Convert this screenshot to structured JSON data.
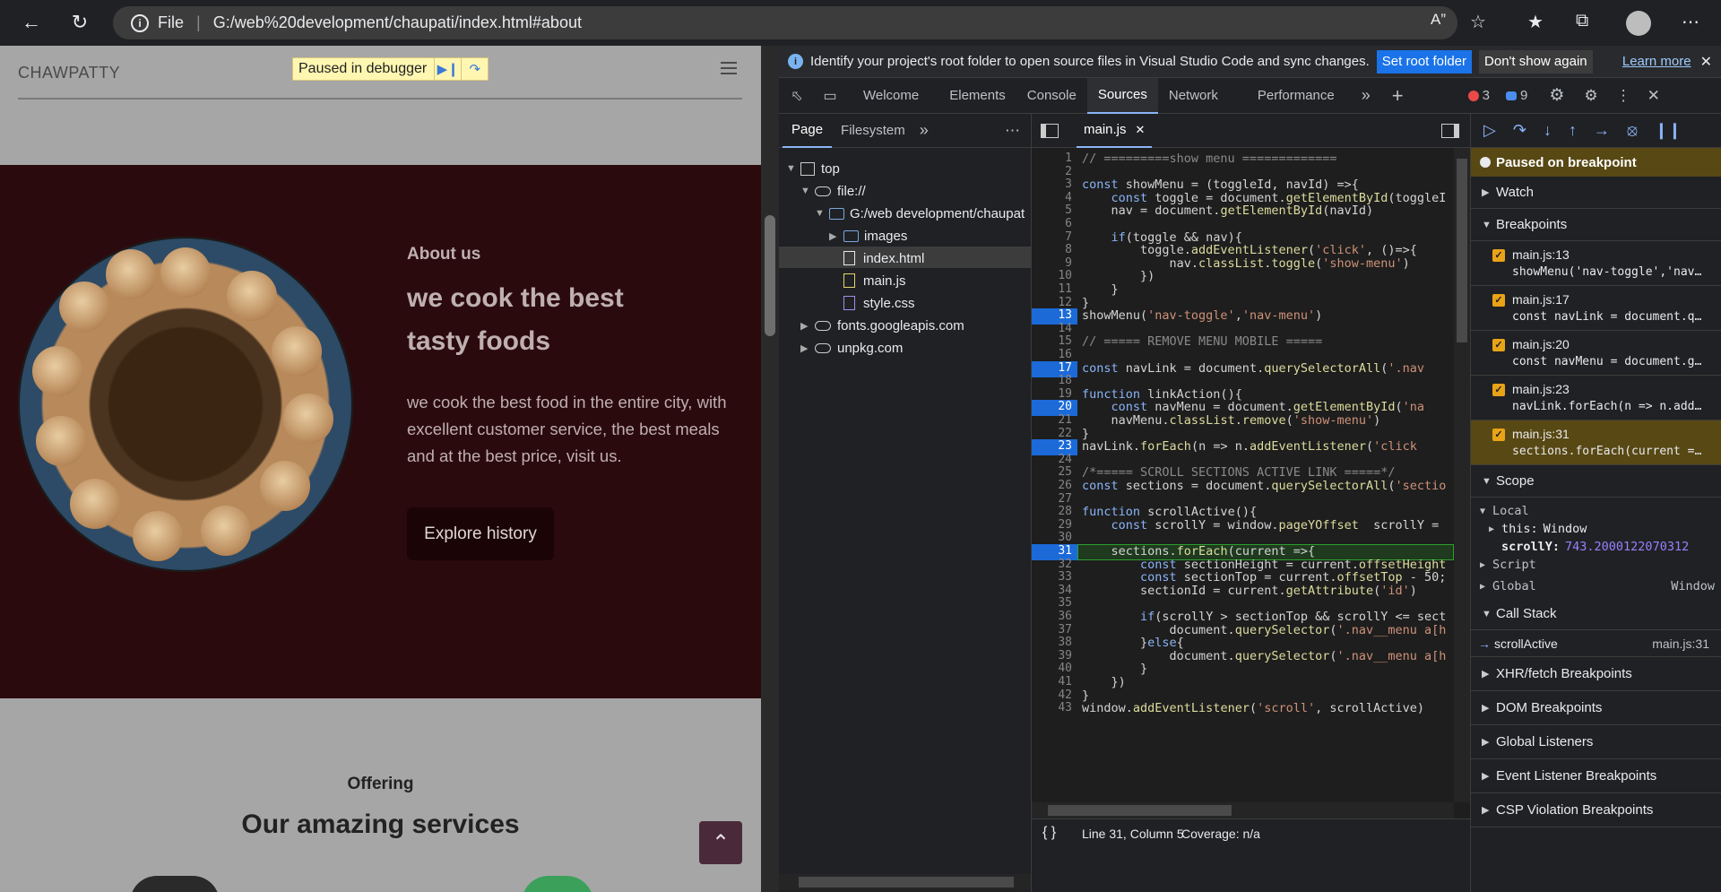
{
  "browser": {
    "url_label": "File",
    "url": "G:/web%20development/chaupati/index.html#about"
  },
  "page": {
    "brand": "CHAWPATTY",
    "paused_label": "Paused in debugger",
    "about_subtitle": "About us",
    "about_title_1": "we cook the best",
    "about_title_2": "tasty foods",
    "about_desc": "we cook the best food in the entire city, with excellent customer service, the best meals and at the best price, visit us.",
    "explore_button": "Explore history",
    "offer_subtitle": "Offering",
    "offer_title": "Our amazing services",
    "colors": {
      "about_bg": "#2b0a0d",
      "page_bg": "#a6a6a6"
    }
  },
  "devtools": {
    "info_message": "Identify your project's root folder to open source files in Visual Studio Code and sync changes.",
    "set_root": "Set root folder",
    "dont_show": "Don't show again",
    "learn_more": "Learn more",
    "tabs": [
      "Welcome",
      "Elements",
      "Console",
      "Sources",
      "Network",
      "Performance"
    ],
    "active_tab": "Sources",
    "error_count": "3",
    "message_count": "9",
    "nav_tabs": [
      "Page",
      "Filesystem"
    ],
    "tree": {
      "top": "top",
      "file": "file://",
      "folder": "G:/web development/chaupat",
      "images": "images",
      "index": "index.html",
      "mainjs": "main.js",
      "style": "style.css",
      "fonts": "fonts.googleapis.com",
      "unpkg": "unpkg.com"
    },
    "editor_tab": "main.js",
    "code_lines": [
      "// =========show menu =============",
      "",
      "const showMenu = (toggleId, navId) =>{",
      "    const toggle = document.getElementById(toggleI",
      "    nav = document.getElementById(navId)",
      "",
      "    if(toggle && nav){",
      "        toggle.addEventListener('click', ()=>{",
      "            nav.classList.toggle('show-menu')",
      "        })",
      "    }",
      "}",
      "showMenu('nav-toggle','nav-menu')",
      "",
      "// ===== REMOVE MENU MOBILE =====",
      "",
      "const navLink = document.querySelectorAll('.nav",
      "",
      "function linkAction(){",
      "    const navMenu = document.getElementById('na",
      "    navMenu.classList.remove('show-menu')",
      "}",
      "navLink.forEach(n => n.addEventListener('click",
      "",
      "/*===== SCROLL SECTIONS ACTIVE LINK =====*/",
      "const sections = document.querySelectorAll('sectio",
      "",
      "function scrollActive(){",
      "    const scrollY = window.pageYOffset  scrollY =",
      "",
      "    sections.forEach(current =>{",
      "        const sectionHeight = current.offsetHeight",
      "        const sectionTop = current.offsetTop - 50;",
      "        sectionId = current.getAttribute('id')",
      "",
      "        if(scrollY > sectionTop && scrollY <= sect",
      "            document.querySelector('.nav__menu a[h",
      "        }else{",
      "            document.querySelector('.nav__menu a[h",
      "        }",
      "    })",
      "}",
      "window.addEventListener('scroll', scrollActive)"
    ],
    "breakpoint_lines": [
      13,
      17,
      20,
      23,
      31
    ],
    "current_line": 31,
    "status_cursor": "Line 31, Column 5",
    "status_coverage": "Coverage: n/a",
    "paused_banner": "Paused on breakpoint",
    "sections": {
      "watch": "Watch",
      "breakpoints": "Breakpoints",
      "scope": "Scope",
      "call_stack": "Call Stack",
      "xhr": "XHR/fetch Breakpoints",
      "dom": "DOM Breakpoints",
      "global_listeners": "Global Listeners",
      "event_listener": "Event Listener Breakpoints",
      "csp": "CSP Violation Breakpoints"
    },
    "breakpoints": [
      {
        "loc": "main.js:13",
        "src": "showMenu('nav-toggle','nav…"
      },
      {
        "loc": "main.js:17",
        "src": "const navLink = document.q…"
      },
      {
        "loc": "main.js:20",
        "src": "const navMenu = document.g…"
      },
      {
        "loc": "main.js:23",
        "src": "navLink.forEach(n => n.add…"
      },
      {
        "loc": "main.js:31",
        "src": "sections.forEach(current =…"
      }
    ],
    "scope": {
      "local": "Local",
      "this_key": "this:",
      "this_val": "Window",
      "scrolly_key": "scrollY:",
      "scrolly_val": "743.2000122070312",
      "script": "Script",
      "global": "Global",
      "global_val": "Window"
    },
    "call_stack": {
      "fn": "scrollActive",
      "loc": "main.js:31"
    }
  }
}
